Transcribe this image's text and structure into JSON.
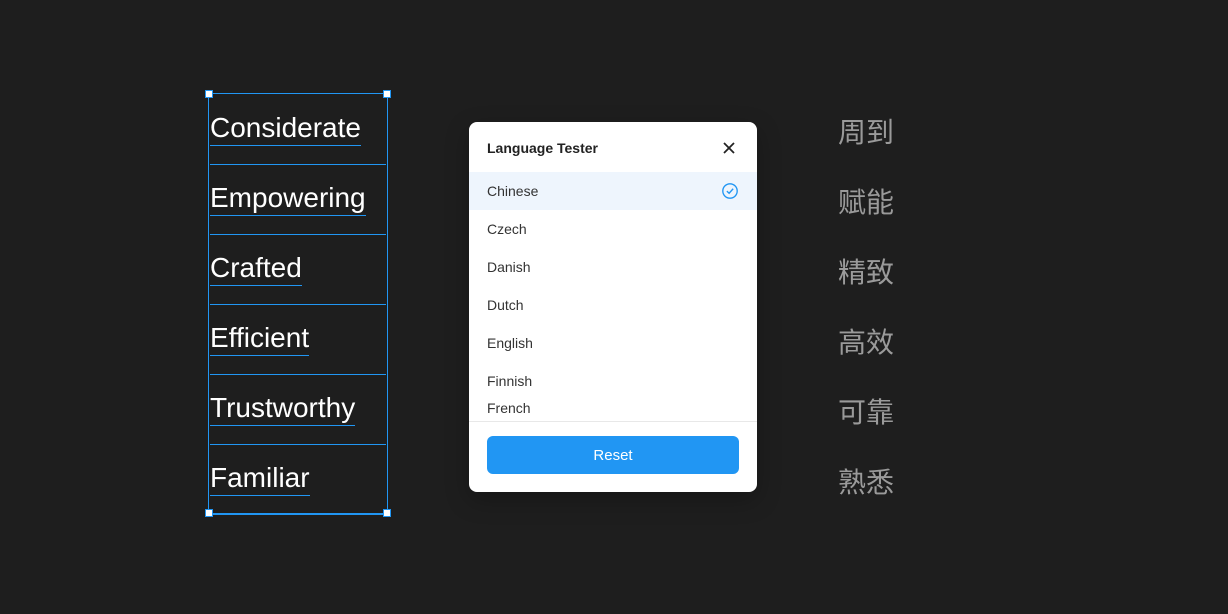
{
  "left_words": [
    "Considerate",
    "Empowering",
    "Crafted",
    "Efficient",
    "Trustworthy",
    "Familiar"
  ],
  "right_words": [
    "周到",
    "赋能",
    "精致",
    "高效",
    "可靠",
    "熟悉"
  ],
  "panel": {
    "title": "Language Tester",
    "reset_label": "Reset",
    "languages": [
      {
        "label": "Chinese",
        "selected": true
      },
      {
        "label": "Czech",
        "selected": false
      },
      {
        "label": "Danish",
        "selected": false
      },
      {
        "label": "Dutch",
        "selected": false
      },
      {
        "label": "English",
        "selected": false
      },
      {
        "label": "Finnish",
        "selected": false
      },
      {
        "label": "French",
        "selected": false
      }
    ]
  }
}
